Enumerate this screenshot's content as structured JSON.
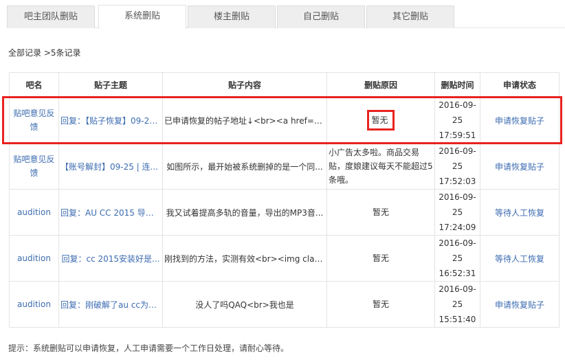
{
  "tabs": [
    {
      "label": "吧主团队删贴",
      "active": false
    },
    {
      "label": "系统删贴",
      "active": true
    },
    {
      "label": "楼主删贴",
      "active": false
    },
    {
      "label": "自己删贴",
      "active": false
    },
    {
      "label": "其它删贴",
      "active": false
    }
  ],
  "summary": "全部记录 >5条记录",
  "table": {
    "headers": [
      "吧名",
      "贴子主题",
      "贴子内容",
      "删贴原因",
      "删贴时间",
      "申请状态"
    ],
    "rows": [
      {
        "bar": "贴吧意见反馈",
        "subject": "回复：【贴子恢复】09-25 ...",
        "content": "已申请恢复的帖子地址↓<br><a href=\"http:...",
        "reason": "暂无",
        "date": "2016-09-25",
        "time": "17:59:51",
        "status": "申请恢复贴子"
      },
      {
        "bar": "贴吧意见反馈",
        "subject": "【账号解封】09-25 | 连...",
        "content": "如图所示，最开始被系统删掉的是一个同...",
        "reason": "小广告太多啦。商品交易贴，度娘建议每天不能超过5条哦。",
        "date": "2016-09-25",
        "time": "17:52:03",
        "status": "申请恢复贴子"
      },
      {
        "bar": "audition",
        "subject": "回复：AU CC 2015 导出...",
        "content": "我又试着提高多轨的音量，导出的MP3音...",
        "reason": "暂无",
        "date": "2016-09-25",
        "time": "17:24:09",
        "status": "等待人工恢复"
      },
      {
        "bar": "audition",
        "subject": "回复：cc 2015安装好是...",
        "content": "刚找到的方法，实测有效<br><img class=...",
        "reason": "暂无",
        "date": "2016-09-25",
        "time": "16:52:31",
        "status": "等待人工恢复"
      },
      {
        "bar": "audition",
        "subject": "回复：刚破解了au cc为什...",
        "content": "没人了吗QAQ<br>我也是",
        "reason": "暂无",
        "date": "2016-09-25",
        "time": "15:51:40",
        "status": "申请恢复贴子"
      }
    ]
  },
  "tip": "提示：系统删贴可以申请恢复，人工申请需要一个工作日处理，请耐心等待。",
  "colors": {
    "link": "#3b6bb0",
    "highlight": "#e8221f"
  }
}
